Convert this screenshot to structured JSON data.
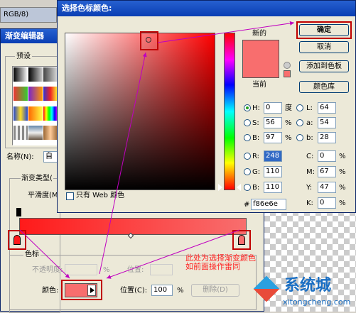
{
  "bg": {
    "doc_tab": "RGB/8)"
  },
  "gradient_editor": {
    "title": "渐变编辑器",
    "presets_label": "预设",
    "name_label": "名称(N):",
    "name_value": "自",
    "type_label": "渐变类型(",
    "smooth_label": "平滑度(M",
    "stops_label": "色标",
    "opacity_label": "不透明度:",
    "opacity_unit": "%",
    "location_label": "位置:",
    "color_label": "颜色:",
    "location2_label": "位置(C):",
    "location2_value": "100",
    "location2_unit": "%",
    "delete_label": "删除(D)",
    "gradient_start": "#ff1a1a",
    "gradient_end": "#f86e6e"
  },
  "picker": {
    "title": "选择色标颜色:",
    "new_label": "新的",
    "current_label": "当前",
    "ok_label": "确定",
    "cancel_label": "取消",
    "add_swatch_label": "添加到色板",
    "libraries_label": "颜色库",
    "web_only_label": "只有 Web 颜色",
    "hsb": [
      {
        "name": "H:",
        "value": "0",
        "unit": "度"
      },
      {
        "name": "S:",
        "value": "56",
        "unit": "%"
      },
      {
        "name": "B:",
        "value": "97",
        "unit": "%"
      }
    ],
    "rgb": [
      {
        "name": "R:",
        "value": "248"
      },
      {
        "name": "G:",
        "value": "110"
      },
      {
        "name": "B:",
        "value": "110"
      }
    ],
    "lab": [
      {
        "name": "L:",
        "value": "64"
      },
      {
        "name": "a:",
        "value": "54"
      },
      {
        "name": "b:",
        "value": "28"
      }
    ],
    "cmyk": [
      {
        "name": "C:",
        "value": "0",
        "unit": "%"
      },
      {
        "name": "M:",
        "value": "67",
        "unit": "%"
      },
      {
        "name": "Y:",
        "value": "47",
        "unit": "%"
      },
      {
        "name": "K:",
        "value": "0",
        "unit": "%"
      }
    ],
    "hex_label": "#",
    "hex_value": "f86e6e",
    "new_color": "#f86e6e",
    "current_color": "#f86e6e"
  },
  "annotation": {
    "line1": "此处为选择渐变颜色",
    "line2": "如前面操作雷同"
  },
  "watermark": {
    "name": "系统城",
    "url": "xitongcheng.com"
  }
}
